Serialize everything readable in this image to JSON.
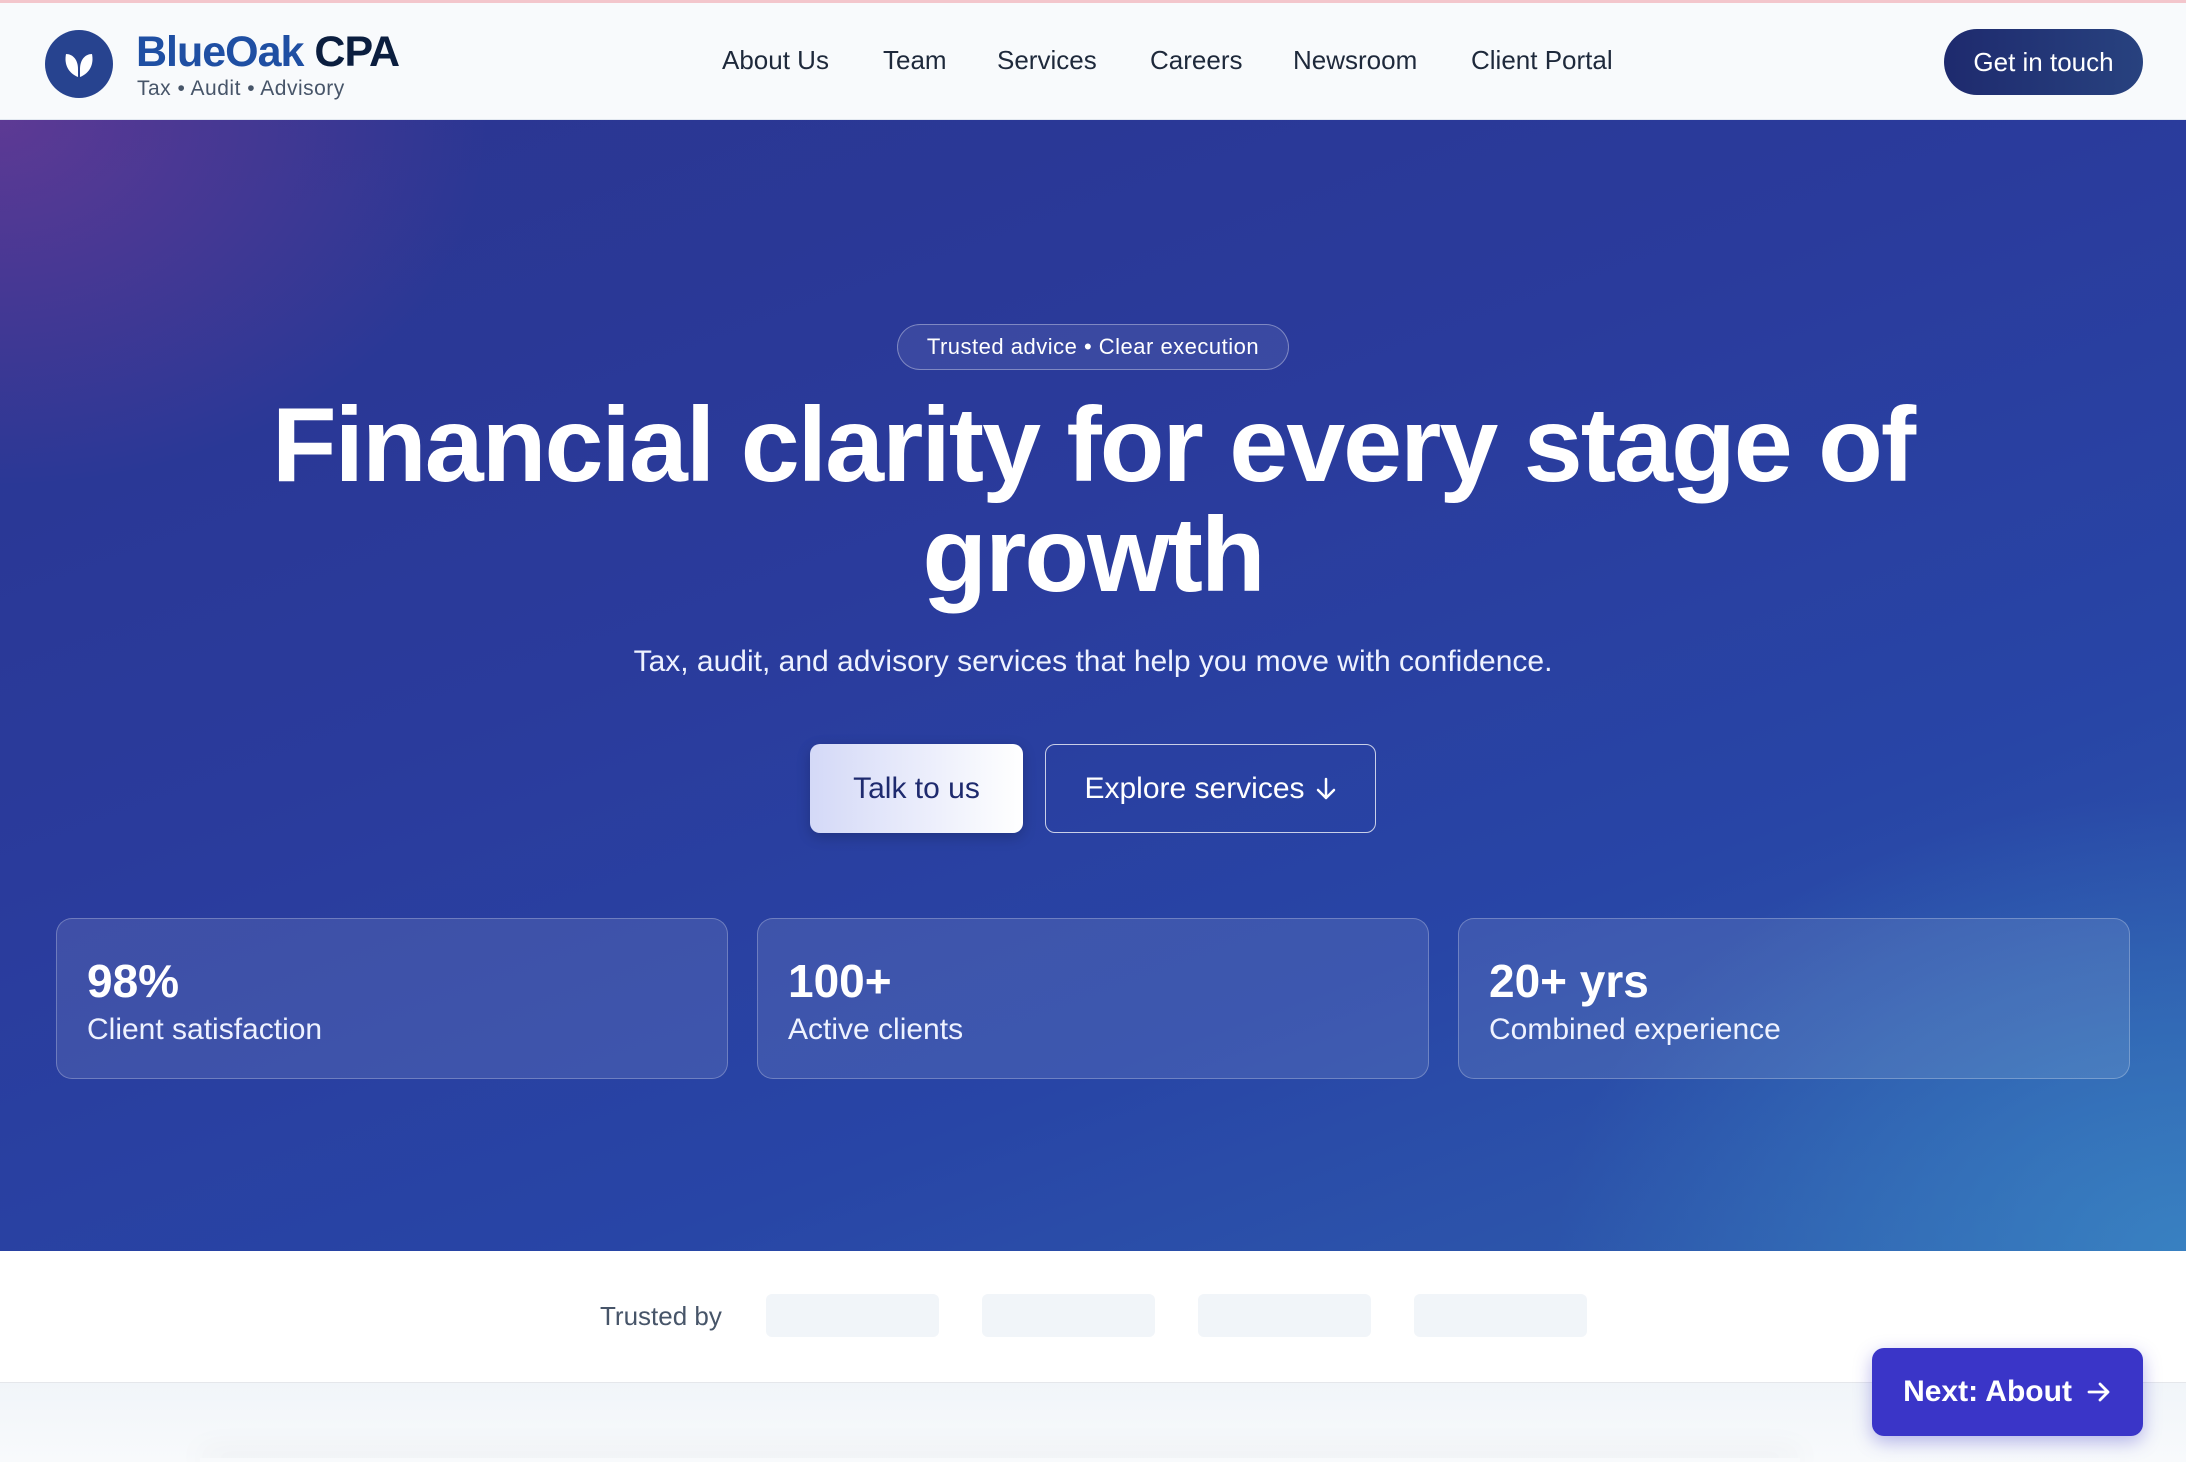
{
  "header": {
    "brand_part1": "BlueOak",
    "brand_part2": "CPA",
    "tagline": "Tax • Audit • Advisory",
    "nav": [
      "About Us",
      "Team",
      "Services",
      "Careers",
      "Newsroom",
      "Client Portal"
    ],
    "cta_label": "Get in touch"
  },
  "hero": {
    "badge": "Trusted advice • Clear execution",
    "title": "Financial clarity for every stage of growth",
    "subtitle": "Tax, audit, and advisory services that help you move with confidence.",
    "primary_button": "Talk to us",
    "secondary_button": "Explore services",
    "stats": [
      {
        "value": "98%",
        "label": "Client satisfaction"
      },
      {
        "value": "100+",
        "label": "Active clients"
      },
      {
        "value": "20+ yrs",
        "label": "Combined experience"
      }
    ]
  },
  "trusted": {
    "label": "Trusted by"
  },
  "next_button": "Next: About",
  "icons": {
    "logo": "leaf-logo-icon",
    "secondary_button": "arrow-down-icon",
    "next_button": "arrow-right-icon"
  },
  "colors": {
    "brand_blue": "#1f4fa3",
    "brand_dark": "#0b1e3f",
    "header_cta": "#1e2a6e",
    "hero_bg": "#2a3b9c",
    "next_button": "#3a35c8"
  }
}
